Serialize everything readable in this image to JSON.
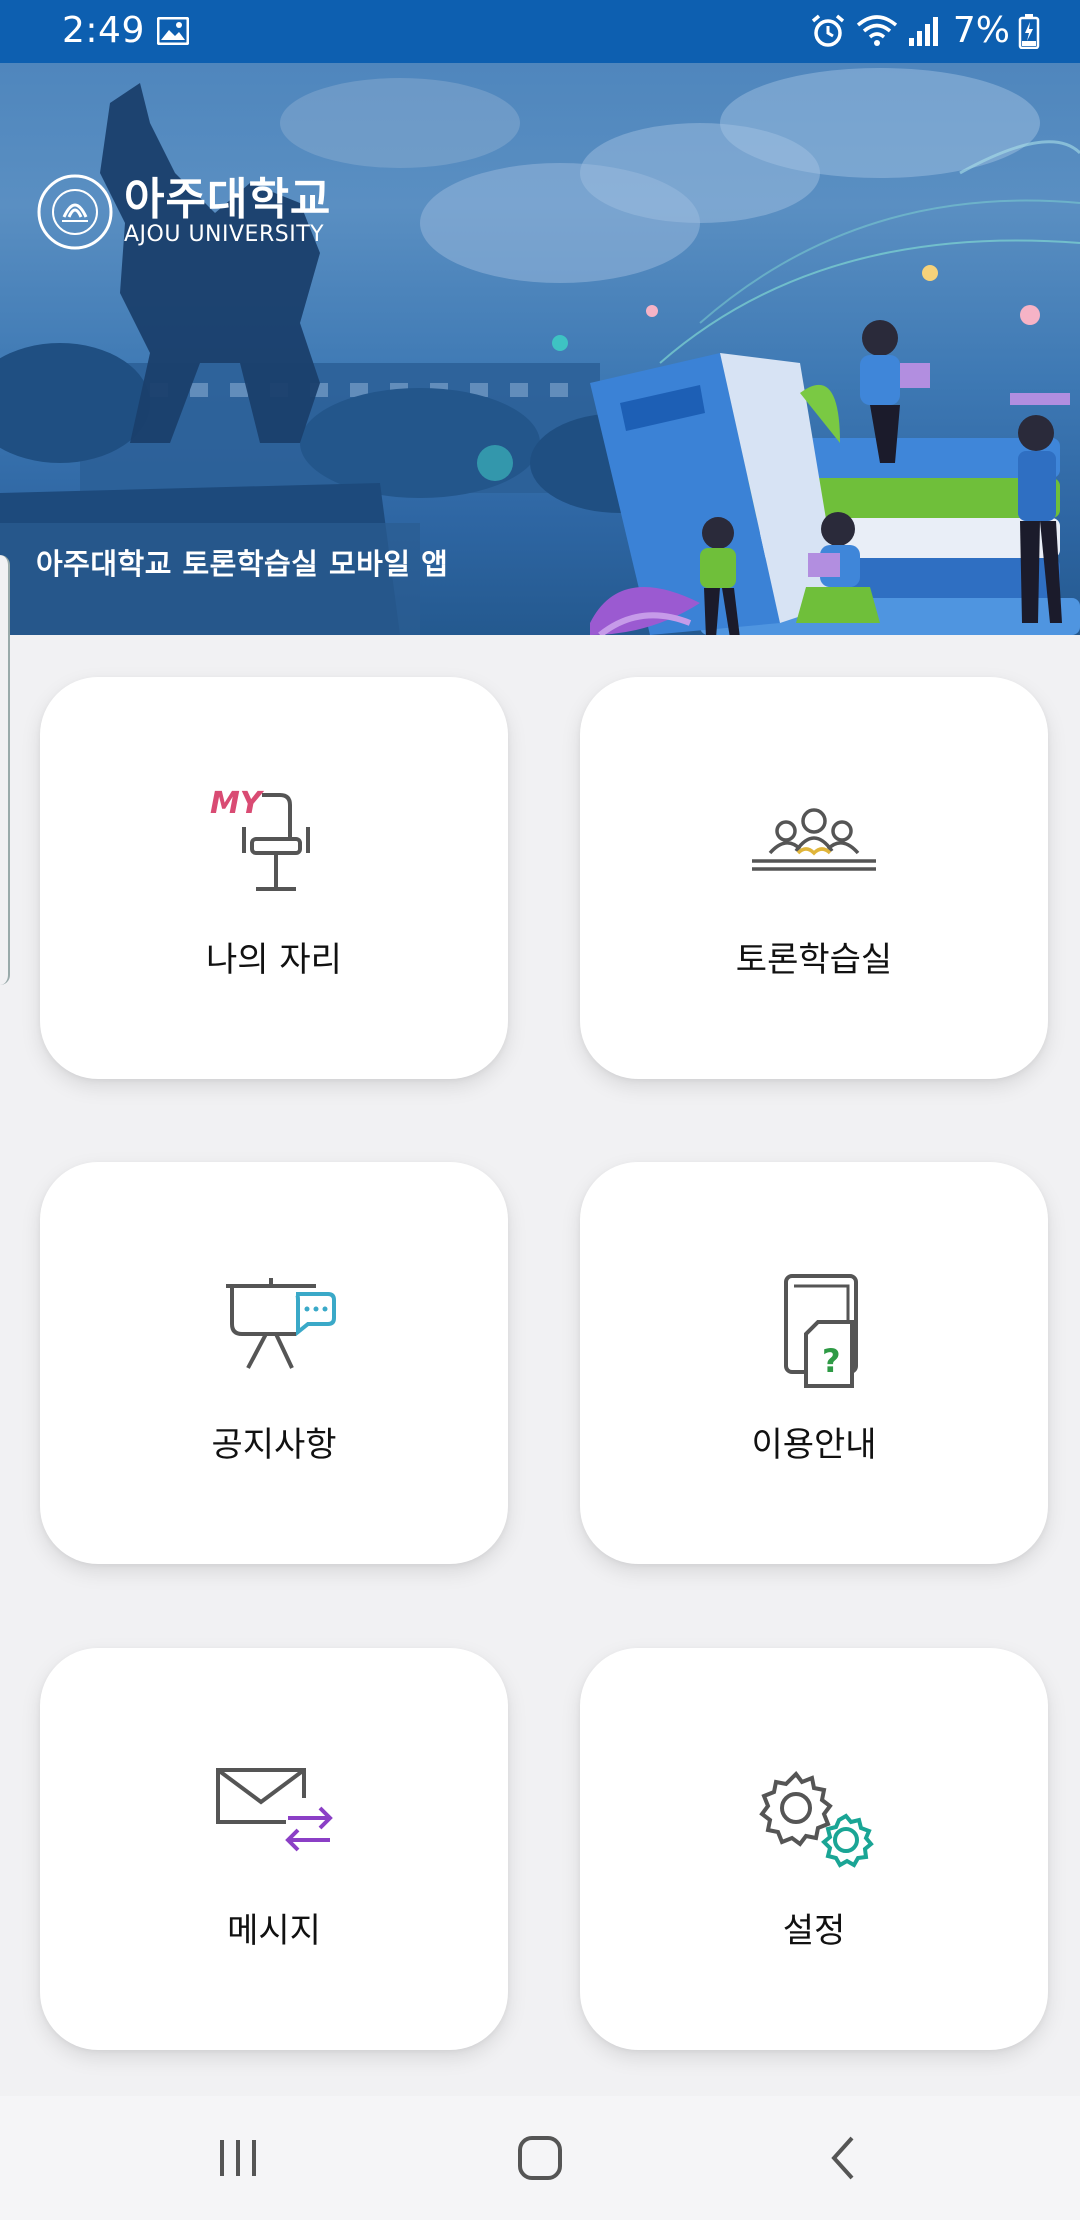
{
  "status_bar": {
    "time": "2:49",
    "battery": "7%",
    "icons": [
      "image-icon",
      "alarm-icon",
      "wifi-icon",
      "signal-icon",
      "battery-charging-icon"
    ]
  },
  "hero": {
    "logo_korean": "아주대학교",
    "logo_english": "AJOU UNIVERSITY",
    "caption": "아주대학교 토론학습실 모바일 앱"
  },
  "menu": {
    "my_seat": "나의 자리",
    "my_badge": "MY",
    "discussion_room": "토론학습실",
    "notices": "공지사항",
    "guide": "이용안내",
    "messages": "메시지",
    "settings": "설정"
  },
  "colors": {
    "status_bar": "#0d5fb0",
    "background": "#f1f1f3",
    "card": "#ffffff",
    "accent_pink": "#d94b73",
    "accent_teal": "#1aa595",
    "accent_purple": "#8b3fc6",
    "accent_cyan": "#3aa9c8",
    "accent_yellow": "#e0b53a",
    "accent_green": "#2e9a45"
  },
  "nav": {
    "icons": [
      "recent-apps-icon",
      "home-icon",
      "back-icon"
    ]
  }
}
